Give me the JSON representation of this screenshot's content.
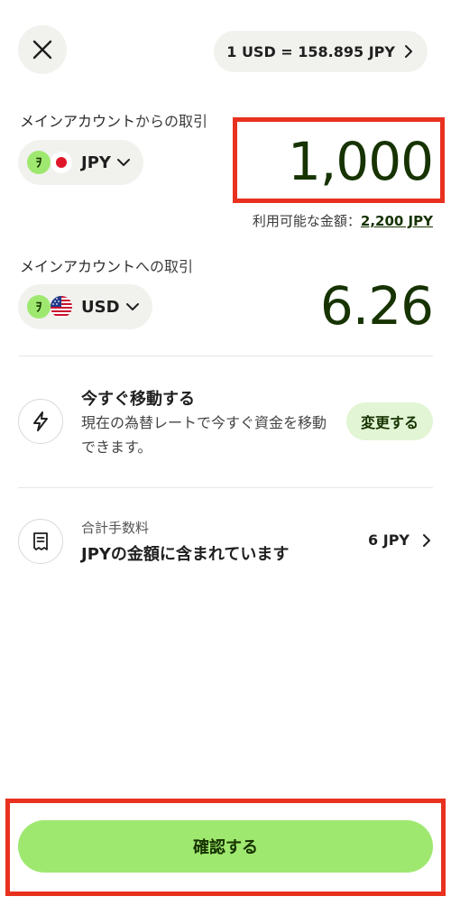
{
  "header": {
    "close_icon": "close-icon",
    "rate_text": "1 USD = 158.895 JPY"
  },
  "from": {
    "label_strong": "メインアカウント",
    "label_rest": "からの取引",
    "badge": "ｦ",
    "currency": "JPY",
    "amount": "1,000",
    "available_label": "利用可能な金額：",
    "available_value": "2,200 JPY"
  },
  "to": {
    "label_strong": "メインアカウント",
    "label_rest": "への取引",
    "badge": "ｦ",
    "currency": "USD",
    "amount": "6.26"
  },
  "transfer": {
    "title": "今すぐ移動する",
    "description": "現在の為替レートで今すぐ資金を移動できます。",
    "change_label": "変更する"
  },
  "fee": {
    "label": "合計手数料",
    "description": "JPYの金額に含まれています",
    "value": "6 JPY"
  },
  "footer": {
    "confirm_label": "確認する"
  },
  "colors": {
    "brand_green": "#9fe870",
    "dark_green": "#163300",
    "highlight_red": "#e8311f"
  }
}
